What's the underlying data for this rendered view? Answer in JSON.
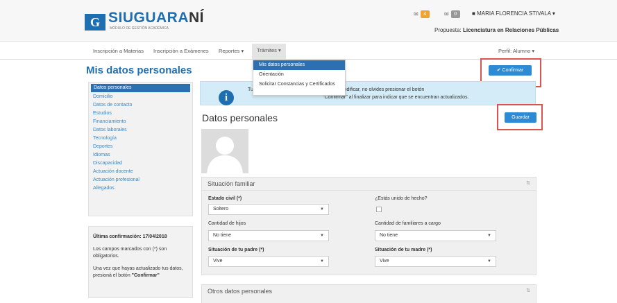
{
  "header": {
    "logo_text_blue": "SIUGUARA",
    "logo_text_dark": "NÍ",
    "logo_full": "SIUGUARANÍ",
    "logo_subtitle": "Módulo de gestión académica",
    "logo_letter": "G",
    "badge1_count": "4",
    "badge2_count": "0",
    "badge1_color": "#f0a32e",
    "badge2_color": "#999999",
    "user_name": "MARIA FLORENCIA STIVALA",
    "propuesta_label": "Propuesta:",
    "propuesta_value": "Licenciatura en Relaciones Públicas"
  },
  "nav": {
    "items": [
      "Inscripción a Materias",
      "Inscripción a Exámenes",
      "Reportes",
      "Trámites"
    ],
    "profile": "Perfil: Alumno"
  },
  "dropdown": {
    "items": [
      "Mis datos personales",
      "Orientación",
      "Solicitar Constancias y Certificados"
    ]
  },
  "page": {
    "title": "Mis datos personales",
    "confirm_button": "✔ Confirmar",
    "save_button": "Guardar",
    "section_title": "Datos personales"
  },
  "sidebar": {
    "items": [
      "Datos personales",
      "Domicilio",
      "Datos de contacto",
      "Estudios",
      "Financiamiento",
      "Datos laborales",
      "Tecnología",
      "Deportes",
      "Idiomas",
      "Discapacidad",
      "Actuación docente",
      "Actuación profesional",
      "Allegados"
    ]
  },
  "info": {
    "last_confirmation": "Última confirmación: 17/04/2018",
    "required_note": "Los campos marcados con (*) son obligatorios.",
    "confirm_note_pre": "Una vez que hayas actualizado tus datos, presioná el botón",
    "confirm_note_bold": "\"Confirmar\""
  },
  "alert": {
    "line1": "Tus d...                                 maneras, si tenés algún dato para modificar, no olvides presionar el botón",
    "line2": "\"Confirmar\" al finalizar para indicar que se encuentran actualizados."
  },
  "situacion": {
    "title": "Situación familiar",
    "estado_civil_label": "Estado civil (*)",
    "estado_civil_value": "Soltero",
    "union_label": "¿Estás unido de hecho?",
    "hijos_label": "Cantidad de hijos",
    "hijos_value": "No tiene",
    "familiares_label": "Cantidad de familiares a cargo",
    "familiares_value": "No tiene",
    "padre_label": "Situación de tu padre (*)",
    "padre_value": "Vive",
    "madre_label": "Situación de tu madre (*)",
    "madre_value": "Vive"
  },
  "otros": {
    "title": "Otros datos personales"
  }
}
